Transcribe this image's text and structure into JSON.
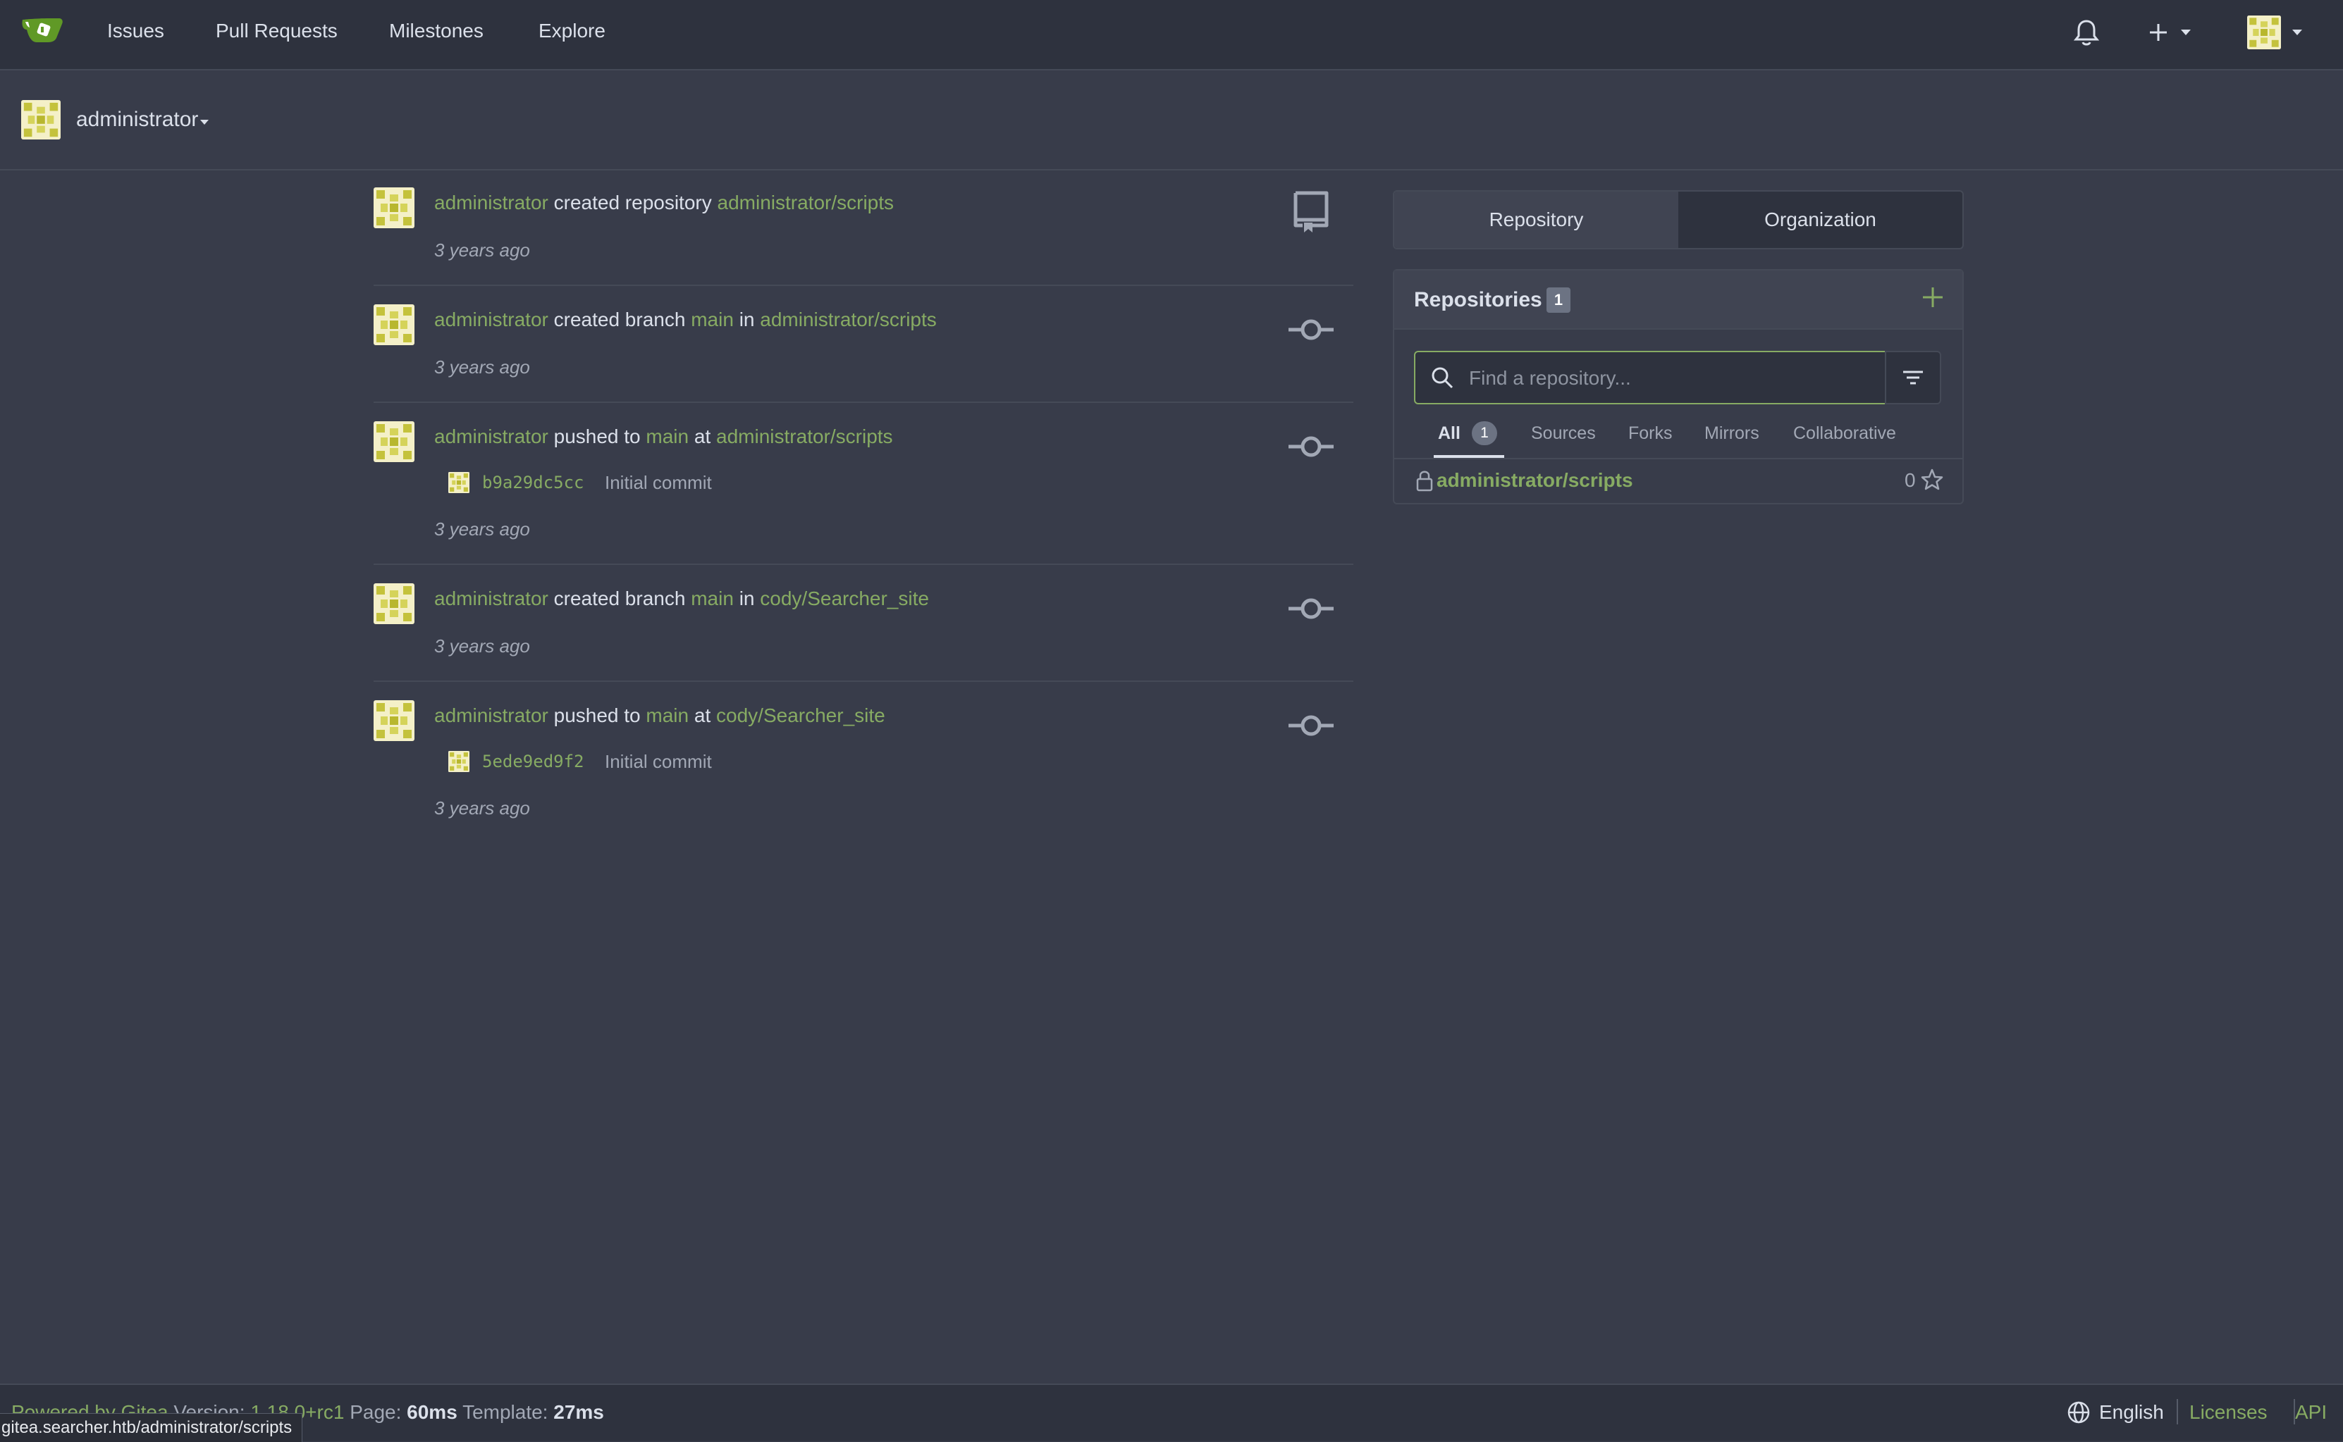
{
  "nav": {
    "items": [
      "Issues",
      "Pull Requests",
      "Milestones",
      "Explore"
    ]
  },
  "context": {
    "user": "administrator"
  },
  "feed": [
    {
      "actor": "administrator",
      "action": "created repository",
      "target": "administrator/scripts",
      "time": "3 years ago",
      "icon": "repo-icon"
    },
    {
      "actor": "administrator",
      "action": "created branch",
      "branch": "main",
      "prep": "in",
      "target": "administrator/scripts",
      "time": "3 years ago",
      "icon": "commit-icon"
    },
    {
      "actor": "administrator",
      "action": "pushed to",
      "branch": "main",
      "prep": "at",
      "target": "administrator/scripts",
      "commit": {
        "hash": "b9a29dc5cc",
        "message": "Initial commit"
      },
      "time": "3 years ago",
      "icon": "commit-icon"
    },
    {
      "actor": "administrator",
      "action": "created branch",
      "branch": "main",
      "prep": "in",
      "target": "cody/Searcher_site",
      "time": "3 years ago",
      "icon": "commit-icon"
    },
    {
      "actor": "administrator",
      "action": "pushed to",
      "branch": "main",
      "prep": "at",
      "target": "cody/Searcher_site",
      "commit": {
        "hash": "5ede9ed9f2",
        "message": "Initial commit"
      },
      "time": "3 years ago",
      "icon": "commit-icon"
    }
  ],
  "panel": {
    "tabs": [
      "Repository",
      "Organization"
    ],
    "title": "Repositories",
    "count": "1",
    "search_placeholder": "Find a repository...",
    "filters": [
      "All",
      "Sources",
      "Forks",
      "Mirrors",
      "Collaborative"
    ],
    "all_count": "1",
    "repos": [
      {
        "name": "administrator/scripts",
        "stars": "0"
      }
    ]
  },
  "footer": {
    "powered": "Powered by Gitea",
    "version_label": "Version:",
    "version": "1.18.0+rc1",
    "page_label": "Page:",
    "page_time": "60ms",
    "template_label": "Template:",
    "template_time": "27ms",
    "language": "English",
    "licenses": "Licenses",
    "api": "API"
  },
  "status_url": "gitea.searcher.htb/administrator/scripts",
  "colors": {
    "accent": "#87ab63",
    "bg": "#383c4a",
    "nav_bg": "#2e323e"
  }
}
